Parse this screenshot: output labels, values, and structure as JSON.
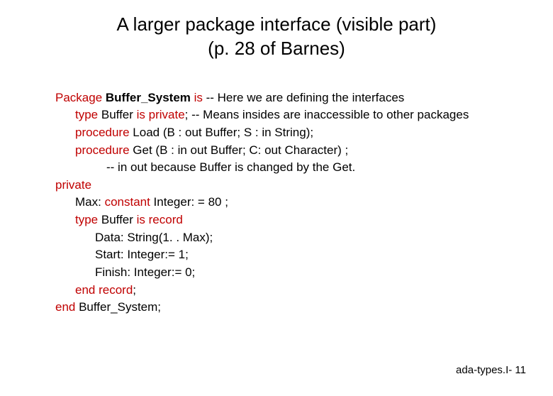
{
  "title": {
    "line1": "A larger package interface (visible part)",
    "line2": "(p. 28 of Barnes)"
  },
  "code": {
    "l1_kw1": "Package",
    "l1_ident": " Buffer_System ",
    "l1_kw2": "is",
    "l1_comment": "    -- Here we are defining the interfaces",
    "l2_kw1": "type",
    "l2_text1": " Buffer ",
    "l2_kw2": "is private",
    "l2_text2": ";  -- Means insides are inaccessible to other packages",
    "l3_kw": "procedure",
    "l3_text": " Load (B : out Buffer; S : in String);",
    "l4_kw": "procedure",
    "l4_text": " Get (B : in out Buffer; C: out Character) ;",
    "l5_text": "-- in out because Buffer is changed by the Get.",
    "l6_kw": "private",
    "l7_text1": "Max: ",
    "l7_kw": "constant",
    "l7_text2": " Integer: = 80 ;",
    "l8_kw1": "type",
    "l8_text1": " Buffer ",
    "l8_kw2": "is record",
    "l9_text": "Data: String(1. . Max);",
    "l10_text": "Start: Integer:= 1;",
    "l11_text": "Finish: Integer:= 0;",
    "l12_kw": "end record",
    "l12_text": ";",
    "l13_kw": "end",
    "l13_text": " Buffer_System;"
  },
  "footer": "ada-types.I- 11"
}
